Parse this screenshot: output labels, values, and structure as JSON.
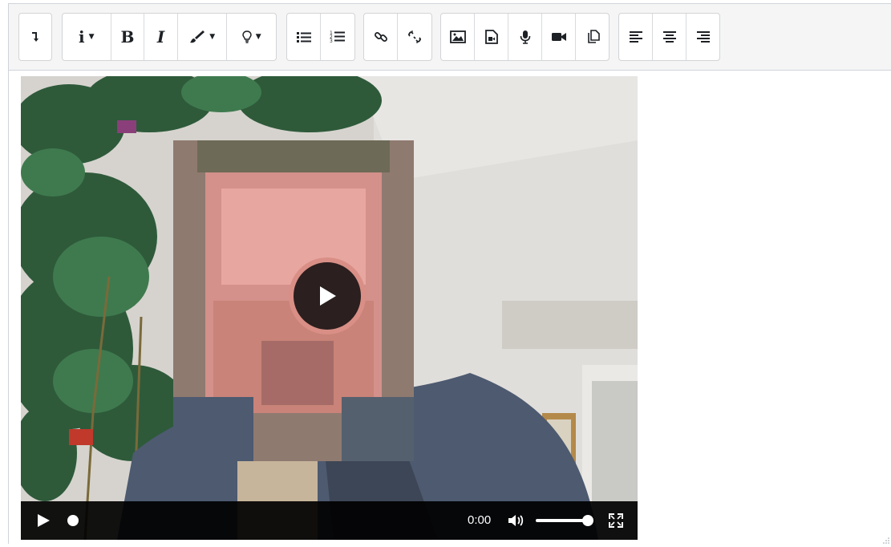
{
  "toolbar": {
    "groups": [
      {
        "name": "collapse",
        "buttons": [
          "collapse"
        ]
      },
      {
        "name": "style",
        "buttons": [
          "info",
          "bold",
          "italic",
          "brush",
          "lightbulb"
        ]
      },
      {
        "name": "list",
        "buttons": [
          "unordered-list",
          "ordered-list"
        ]
      },
      {
        "name": "links",
        "buttons": [
          "link",
          "unlink"
        ]
      },
      {
        "name": "insert",
        "buttons": [
          "image",
          "media",
          "record-audio",
          "record-video",
          "manage-files"
        ]
      },
      {
        "name": "align",
        "buttons": [
          "align-left",
          "align-center",
          "align-right"
        ]
      }
    ],
    "bold_label": "B",
    "italic_label": "I",
    "info_label": "i"
  },
  "video": {
    "time": "0:00",
    "progress": 0,
    "volume": 1.0
  },
  "colors": {
    "toolbar_bg": "#f5f5f5",
    "play_ring": "#d98f86"
  }
}
